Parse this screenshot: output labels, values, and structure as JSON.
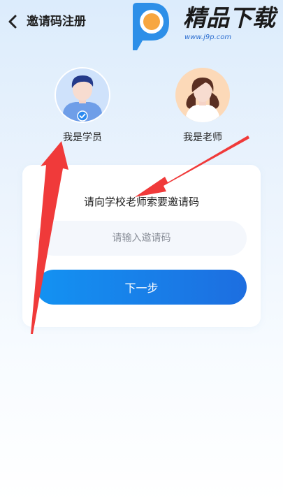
{
  "header": {
    "title": "邀请码注册",
    "back_icon": "chevron-left-icon"
  },
  "watermark": {
    "title": "精品下载",
    "url": "www.j9p.com",
    "logo_icon": "p-logo-icon"
  },
  "roles": {
    "student": {
      "label": "我是学员",
      "selected": true,
      "badge_icon": "check-badge-icon"
    },
    "teacher": {
      "label": "我是老师",
      "selected": false
    }
  },
  "card": {
    "title": "请向学校老师索要邀请码",
    "input": {
      "value": "",
      "placeholder": "请输入邀请码"
    },
    "next_label": "下一步"
  },
  "colors": {
    "primary": "#1a82ea",
    "annotation_arrow": "#f03a3a",
    "watermark_blue": "#2d6fd0",
    "watermark_orange": "#f7a640"
  }
}
